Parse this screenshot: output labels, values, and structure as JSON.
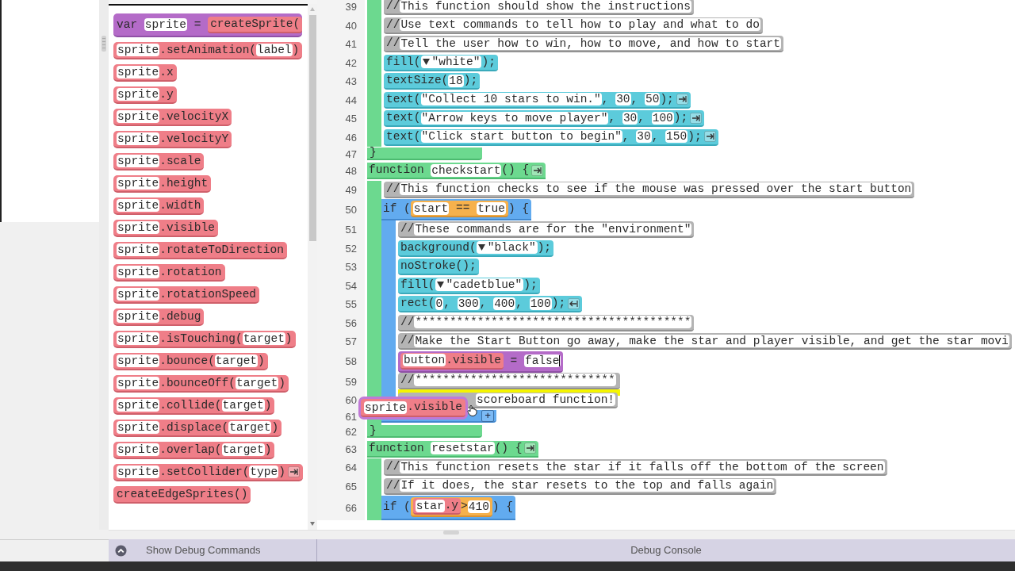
{
  "toolbox": [
    {
      "kind": "var",
      "parts": [
        {
          "kind": "text",
          "text": "var "
        },
        {
          "kind": "slot",
          "text": "sprite"
        },
        {
          "kind": "text",
          "text": " = "
        },
        {
          "kind": "sprite",
          "parts": [
            {
              "kind": "text",
              "text": "createSprite("
            }
          ]
        }
      ]
    },
    {
      "kind": "sprite",
      "parts": [
        {
          "kind": "slot",
          "text": "sprite"
        },
        {
          "kind": "text",
          "text": ".setAnimation("
        },
        {
          "kind": "slot",
          "text": "label"
        },
        {
          "kind": "text",
          "text": ")"
        }
      ]
    },
    {
      "kind": "sprite",
      "parts": [
        {
          "kind": "slot",
          "text": "sprite"
        },
        {
          "kind": "text",
          "text": ".x"
        }
      ]
    },
    {
      "kind": "sprite",
      "parts": [
        {
          "kind": "slot",
          "text": "sprite"
        },
        {
          "kind": "text",
          "text": ".y"
        }
      ]
    },
    {
      "kind": "sprite",
      "parts": [
        {
          "kind": "slot",
          "text": "sprite"
        },
        {
          "kind": "text",
          "text": ".velocityX"
        }
      ]
    },
    {
      "kind": "sprite",
      "parts": [
        {
          "kind": "slot",
          "text": "sprite"
        },
        {
          "kind": "text",
          "text": ".velocityY"
        }
      ]
    },
    {
      "kind": "sprite",
      "parts": [
        {
          "kind": "slot",
          "text": "sprite"
        },
        {
          "kind": "text",
          "text": ".scale"
        }
      ]
    },
    {
      "kind": "sprite",
      "parts": [
        {
          "kind": "slot",
          "text": "sprite"
        },
        {
          "kind": "text",
          "text": ".height"
        }
      ]
    },
    {
      "kind": "sprite",
      "parts": [
        {
          "kind": "slot",
          "text": "sprite"
        },
        {
          "kind": "text",
          "text": ".width"
        }
      ]
    },
    {
      "kind": "sprite",
      "parts": [
        {
          "kind": "slot",
          "text": "sprite"
        },
        {
          "kind": "text",
          "text": ".visible"
        }
      ]
    },
    {
      "kind": "sprite",
      "parts": [
        {
          "kind": "slot",
          "text": "sprite"
        },
        {
          "kind": "text",
          "text": ".rotateToDirection"
        }
      ]
    },
    {
      "kind": "sprite",
      "parts": [
        {
          "kind": "slot",
          "text": "sprite"
        },
        {
          "kind": "text",
          "text": ".rotation"
        }
      ]
    },
    {
      "kind": "sprite",
      "parts": [
        {
          "kind": "slot",
          "text": "sprite"
        },
        {
          "kind": "text",
          "text": ".rotationSpeed"
        }
      ]
    },
    {
      "kind": "sprite",
      "parts": [
        {
          "kind": "slot",
          "text": "sprite"
        },
        {
          "kind": "text",
          "text": ".debug"
        }
      ]
    },
    {
      "kind": "sprite",
      "parts": [
        {
          "kind": "slot",
          "text": "sprite"
        },
        {
          "kind": "text",
          "text": ".isTouching("
        },
        {
          "kind": "slot",
          "text": "target"
        },
        {
          "kind": "text",
          "text": ")"
        }
      ]
    },
    {
      "kind": "sprite",
      "parts": [
        {
          "kind": "slot",
          "text": "sprite"
        },
        {
          "kind": "text",
          "text": ".bounce("
        },
        {
          "kind": "slot",
          "text": "target"
        },
        {
          "kind": "text",
          "text": ")"
        }
      ]
    },
    {
      "kind": "sprite",
      "parts": [
        {
          "kind": "slot",
          "text": "sprite"
        },
        {
          "kind": "text",
          "text": ".bounceOff("
        },
        {
          "kind": "slot",
          "text": "target"
        },
        {
          "kind": "text",
          "text": ")"
        }
      ]
    },
    {
      "kind": "sprite",
      "parts": [
        {
          "kind": "slot",
          "text": "sprite"
        },
        {
          "kind": "text",
          "text": ".collide("
        },
        {
          "kind": "slot",
          "text": "target"
        },
        {
          "kind": "text",
          "text": ")"
        }
      ]
    },
    {
      "kind": "sprite",
      "parts": [
        {
          "kind": "slot",
          "text": "sprite"
        },
        {
          "kind": "text",
          "text": ".displace("
        },
        {
          "kind": "slot",
          "text": "target"
        },
        {
          "kind": "text",
          "text": ")"
        }
      ]
    },
    {
      "kind": "sprite",
      "parts": [
        {
          "kind": "slot",
          "text": "sprite"
        },
        {
          "kind": "text",
          "text": ".overlap("
        },
        {
          "kind": "slot",
          "text": "target"
        },
        {
          "kind": "text",
          "text": ")"
        }
      ]
    },
    {
      "kind": "sprite",
      "parts": [
        {
          "kind": "slot",
          "text": "sprite"
        },
        {
          "kind": "text",
          "text": ".setCollider("
        },
        {
          "kind": "slot",
          "text": "type"
        },
        {
          "kind": "text",
          "text": ")"
        },
        {
          "kind": "arrow_right"
        }
      ]
    },
    {
      "kind": "sprite",
      "parts": [
        {
          "kind": "text",
          "text": "createEdgeSprites()"
        }
      ]
    }
  ],
  "code": [
    {
      "kind": "function",
      "children": [
        {
          "number": "39",
          "kind": "comment",
          "parts": [
            {
              "kind": "text",
              "text": "//"
            },
            {
              "kind": "slot",
              "text": "This function should show the instructions"
            }
          ]
        },
        {
          "number": "40",
          "kind": "comment",
          "parts": [
            {
              "kind": "text",
              "text": "//"
            },
            {
              "kind": "slot",
              "text": "Use text commands to tell how to play and what to do"
            }
          ]
        },
        {
          "number": "41",
          "kind": "comment",
          "parts": [
            {
              "kind": "text",
              "text": "//"
            },
            {
              "kind": "slot",
              "text": "Tell the user how to win, how to move, and how to start"
            }
          ]
        },
        {
          "number": "42",
          "kind": "statement",
          "parts": [
            {
              "kind": "text",
              "text": "fill("
            },
            {
              "kind": "dropdown",
              "text": "\"white\""
            },
            {
              "kind": "text",
              "text": ");"
            }
          ]
        },
        {
          "number": "43",
          "kind": "statement",
          "parts": [
            {
              "kind": "text",
              "text": "textSize("
            },
            {
              "kind": "slot",
              "text": "18"
            },
            {
              "kind": "text",
              "text": ");"
            }
          ]
        },
        {
          "number": "44",
          "kind": "statement",
          "parts": [
            {
              "kind": "text",
              "text": "text("
            },
            {
              "kind": "slot",
              "text": "\"Collect 10 stars to win.\""
            },
            {
              "kind": "text",
              "text": ", "
            },
            {
              "kind": "slot",
              "text": "30"
            },
            {
              "kind": "text",
              "text": ", "
            },
            {
              "kind": "slot",
              "text": "50"
            },
            {
              "kind": "text",
              "text": ");"
            },
            {
              "kind": "arrow_right"
            }
          ]
        },
        {
          "number": "45",
          "kind": "statement",
          "parts": [
            {
              "kind": "text",
              "text": "text("
            },
            {
              "kind": "slot",
              "text": "\"Arrow keys to move player\""
            },
            {
              "kind": "text",
              "text": ", "
            },
            {
              "kind": "slot",
              "text": "30"
            },
            {
              "kind": "text",
              "text": ", "
            },
            {
              "kind": "slot",
              "text": "100"
            },
            {
              "kind": "text",
              "text": ");"
            },
            {
              "kind": "arrow_right"
            }
          ]
        },
        {
          "number": "46",
          "kind": "statement",
          "parts": [
            {
              "kind": "text",
              "text": "text("
            },
            {
              "kind": "slot",
              "text": "\"Click start button to begin\""
            },
            {
              "kind": "text",
              "text": ", "
            },
            {
              "kind": "slot",
              "text": "30"
            },
            {
              "kind": "text",
              "text": ", "
            },
            {
              "kind": "slot",
              "text": "150"
            },
            {
              "kind": "text",
              "text": ");"
            },
            {
              "kind": "arrow_right"
            }
          ]
        }
      ],
      "close": {
        "number": "47",
        "parts": [
          {
            "kind": "text",
            "text": "}"
          }
        ]
      }
    },
    {
      "number": "48",
      "kind": "function",
      "parts": [
        {
          "kind": "text",
          "text": "function "
        },
        {
          "kind": "slot",
          "text": "checkstart"
        },
        {
          "kind": "text",
          "text": "() {"
        },
        {
          "kind": "arrow_right"
        }
      ],
      "children": [
        {
          "number": "49",
          "kind": "comment",
          "parts": [
            {
              "kind": "text",
              "text": "//"
            },
            {
              "kind": "slot",
              "text": "This function checks to see if the mouse was pressed over the start button"
            }
          ]
        },
        {
          "number": "50",
          "kind": "if",
          "parts": [
            {
              "kind": "text",
              "text": "if ("
            },
            {
              "kind": "expression",
              "parts": [
                {
                  "kind": "slot",
                  "text": "start"
                },
                {
                  "kind": "text",
                  "text": " == "
                },
                {
                  "kind": "slot",
                  "text": "true"
                }
              ]
            },
            {
              "kind": "text",
              "text": ") {"
            }
          ],
          "children": [
            {
              "number": "51",
              "kind": "comment",
              "parts": [
                {
                  "kind": "text",
                  "text": "//"
                },
                {
                  "kind": "slot",
                  "text": "These commands are for the \"environment\""
                }
              ]
            },
            {
              "number": "52",
              "kind": "statement",
              "parts": [
                {
                  "kind": "text",
                  "text": "background("
                },
                {
                  "kind": "dropdown",
                  "text": "\"black\""
                },
                {
                  "kind": "text",
                  "text": ");"
                }
              ]
            },
            {
              "number": "53",
              "kind": "statement",
              "parts": [
                {
                  "kind": "text",
                  "text": "noStroke();"
                }
              ]
            },
            {
              "number": "54",
              "kind": "statement",
              "parts": [
                {
                  "kind": "text",
                  "text": "fill("
                },
                {
                  "kind": "dropdown",
                  "text": "\"cadetblue\""
                },
                {
                  "kind": "text",
                  "text": ");"
                }
              ]
            },
            {
              "number": "55",
              "kind": "statement",
              "parts": [
                {
                  "kind": "text",
                  "text": "rect("
                },
                {
                  "kind": "slot",
                  "text": "0"
                },
                {
                  "kind": "text",
                  "text": ", "
                },
                {
                  "kind": "slot",
                  "text": "300"
                },
                {
                  "kind": "text",
                  "text": ", "
                },
                {
                  "kind": "slot",
                  "text": "400"
                },
                {
                  "kind": "text",
                  "text": ", "
                },
                {
                  "kind": "slot",
                  "text": "100"
                },
                {
                  "kind": "text",
                  "text": ");"
                },
                {
                  "kind": "arrow_left"
                }
              ]
            },
            {
              "number": "56",
              "kind": "comment",
              "parts": [
                {
                  "kind": "text",
                  "text": "//"
                },
                {
                  "kind": "slot",
                  "text": "****************************************"
                }
              ]
            },
            {
              "number": "57",
              "kind": "comment",
              "parts": [
                {
                  "kind": "text",
                  "text": "//"
                },
                {
                  "kind": "slot",
                  "text": "Make the Start Button go away, make the star and player visible, and get the star movi"
                }
              ]
            },
            {
              "number": "58",
              "kind": "var",
              "parts": [
                {
                  "kind": "sprite",
                  "parts": [
                    {
                      "kind": "slot",
                      "text": "button"
                    },
                    {
                      "kind": "text",
                      "text": ".visible"
                    }
                  ]
                },
                {
                  "kind": "text",
                  "text": " = "
                },
                {
                  "kind": "slot",
                  "text": "false",
                  "caret": true
                }
              ]
            },
            {
              "number": "59",
              "kind": "comment",
              "drop_marker": true,
              "parts": [
                {
                  "kind": "text",
                  "text": "//"
                },
                {
                  "kind": "slot",
                  "text": "*****************************"
                }
              ]
            },
            {
              "number": "60",
              "kind": "comment",
              "covered": true,
              "parts": [
                {
                  "kind": "slot",
                  "text": "scoreboard function!"
                }
              ]
            }
          ],
          "close": {
            "number": "61",
            "parts": [
              {
                "kind": "button",
                "text": "+"
              }
            ]
          }
        }
      ],
      "close": {
        "number": "62",
        "parts": [
          {
            "kind": "text",
            "text": "}"
          }
        ]
      }
    },
    {
      "number": "63",
      "kind": "function",
      "parts": [
        {
          "kind": "text",
          "text": "function "
        },
        {
          "kind": "slot",
          "text": "resetstar"
        },
        {
          "kind": "text",
          "text": "() {"
        },
        {
          "kind": "arrow_right"
        }
      ],
      "children": [
        {
          "number": "64",
          "kind": "comment",
          "parts": [
            {
              "kind": "text",
              "text": "//"
            },
            {
              "kind": "slot",
              "text": "This function resets the star if it falls off the bottom of the screen"
            }
          ]
        },
        {
          "number": "65",
          "kind": "comment",
          "parts": [
            {
              "kind": "text",
              "text": "//"
            },
            {
              "kind": "slot",
              "text": "If it does, the star resets to the top and falls again"
            }
          ]
        },
        {
          "number": "66",
          "kind": "if",
          "parts": [
            {
              "kind": "text",
              "text": "if ("
            },
            {
              "kind": "expression",
              "parts": [
                {
                  "kind": "sprite",
                  "parts": [
                    {
                      "kind": "slot",
                      "text": "star"
                    },
                    {
                      "kind": "text",
                      "text": ".y"
                    }
                  ]
                },
                {
                  "kind": "text",
                  "text": ">"
                },
                {
                  "kind": "slot",
                  "text": "410"
                }
              ]
            },
            {
              "kind": "text",
              "text": ") {"
            }
          ]
        }
      ]
    }
  ],
  "dragging": {
    "kind": "sprite",
    "parts": [
      {
        "kind": "slot",
        "text": "sprite"
      },
      {
        "kind": "text",
        "text": ".visible"
      }
    ]
  },
  "debug": {
    "commands_label": "Show Debug Commands",
    "console_label": "Debug Console"
  }
}
